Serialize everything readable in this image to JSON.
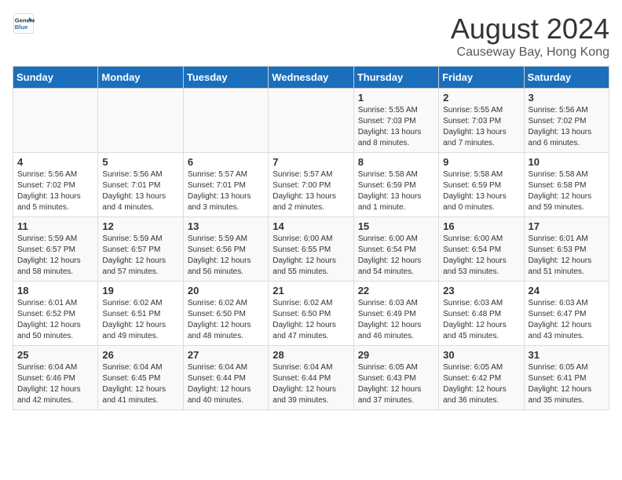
{
  "logo": {
    "line1": "General",
    "line2": "Blue"
  },
  "title": "August 2024",
  "location": "Causeway Bay, Hong Kong",
  "days_of_week": [
    "Sunday",
    "Monday",
    "Tuesday",
    "Wednesday",
    "Thursday",
    "Friday",
    "Saturday"
  ],
  "weeks": [
    [
      {
        "num": "",
        "info": ""
      },
      {
        "num": "",
        "info": ""
      },
      {
        "num": "",
        "info": ""
      },
      {
        "num": "",
        "info": ""
      },
      {
        "num": "1",
        "info": "Sunrise: 5:55 AM\nSunset: 7:03 PM\nDaylight: 13 hours\nand 8 minutes."
      },
      {
        "num": "2",
        "info": "Sunrise: 5:55 AM\nSunset: 7:03 PM\nDaylight: 13 hours\nand 7 minutes."
      },
      {
        "num": "3",
        "info": "Sunrise: 5:56 AM\nSunset: 7:02 PM\nDaylight: 13 hours\nand 6 minutes."
      }
    ],
    [
      {
        "num": "4",
        "info": "Sunrise: 5:56 AM\nSunset: 7:02 PM\nDaylight: 13 hours\nand 5 minutes."
      },
      {
        "num": "5",
        "info": "Sunrise: 5:56 AM\nSunset: 7:01 PM\nDaylight: 13 hours\nand 4 minutes."
      },
      {
        "num": "6",
        "info": "Sunrise: 5:57 AM\nSunset: 7:01 PM\nDaylight: 13 hours\nand 3 minutes."
      },
      {
        "num": "7",
        "info": "Sunrise: 5:57 AM\nSunset: 7:00 PM\nDaylight: 13 hours\nand 2 minutes."
      },
      {
        "num": "8",
        "info": "Sunrise: 5:58 AM\nSunset: 6:59 PM\nDaylight: 13 hours\nand 1 minute."
      },
      {
        "num": "9",
        "info": "Sunrise: 5:58 AM\nSunset: 6:59 PM\nDaylight: 13 hours\nand 0 minutes."
      },
      {
        "num": "10",
        "info": "Sunrise: 5:58 AM\nSunset: 6:58 PM\nDaylight: 12 hours\nand 59 minutes."
      }
    ],
    [
      {
        "num": "11",
        "info": "Sunrise: 5:59 AM\nSunset: 6:57 PM\nDaylight: 12 hours\nand 58 minutes."
      },
      {
        "num": "12",
        "info": "Sunrise: 5:59 AM\nSunset: 6:57 PM\nDaylight: 12 hours\nand 57 minutes."
      },
      {
        "num": "13",
        "info": "Sunrise: 5:59 AM\nSunset: 6:56 PM\nDaylight: 12 hours\nand 56 minutes."
      },
      {
        "num": "14",
        "info": "Sunrise: 6:00 AM\nSunset: 6:55 PM\nDaylight: 12 hours\nand 55 minutes."
      },
      {
        "num": "15",
        "info": "Sunrise: 6:00 AM\nSunset: 6:54 PM\nDaylight: 12 hours\nand 54 minutes."
      },
      {
        "num": "16",
        "info": "Sunrise: 6:00 AM\nSunset: 6:54 PM\nDaylight: 12 hours\nand 53 minutes."
      },
      {
        "num": "17",
        "info": "Sunrise: 6:01 AM\nSunset: 6:53 PM\nDaylight: 12 hours\nand 51 minutes."
      }
    ],
    [
      {
        "num": "18",
        "info": "Sunrise: 6:01 AM\nSunset: 6:52 PM\nDaylight: 12 hours\nand 50 minutes."
      },
      {
        "num": "19",
        "info": "Sunrise: 6:02 AM\nSunset: 6:51 PM\nDaylight: 12 hours\nand 49 minutes."
      },
      {
        "num": "20",
        "info": "Sunrise: 6:02 AM\nSunset: 6:50 PM\nDaylight: 12 hours\nand 48 minutes."
      },
      {
        "num": "21",
        "info": "Sunrise: 6:02 AM\nSunset: 6:50 PM\nDaylight: 12 hours\nand 47 minutes."
      },
      {
        "num": "22",
        "info": "Sunrise: 6:03 AM\nSunset: 6:49 PM\nDaylight: 12 hours\nand 46 minutes."
      },
      {
        "num": "23",
        "info": "Sunrise: 6:03 AM\nSunset: 6:48 PM\nDaylight: 12 hours\nand 45 minutes."
      },
      {
        "num": "24",
        "info": "Sunrise: 6:03 AM\nSunset: 6:47 PM\nDaylight: 12 hours\nand 43 minutes."
      }
    ],
    [
      {
        "num": "25",
        "info": "Sunrise: 6:04 AM\nSunset: 6:46 PM\nDaylight: 12 hours\nand 42 minutes."
      },
      {
        "num": "26",
        "info": "Sunrise: 6:04 AM\nSunset: 6:45 PM\nDaylight: 12 hours\nand 41 minutes."
      },
      {
        "num": "27",
        "info": "Sunrise: 6:04 AM\nSunset: 6:44 PM\nDaylight: 12 hours\nand 40 minutes."
      },
      {
        "num": "28",
        "info": "Sunrise: 6:04 AM\nSunset: 6:44 PM\nDaylight: 12 hours\nand 39 minutes."
      },
      {
        "num": "29",
        "info": "Sunrise: 6:05 AM\nSunset: 6:43 PM\nDaylight: 12 hours\nand 37 minutes."
      },
      {
        "num": "30",
        "info": "Sunrise: 6:05 AM\nSunset: 6:42 PM\nDaylight: 12 hours\nand 36 minutes."
      },
      {
        "num": "31",
        "info": "Sunrise: 6:05 AM\nSunset: 6:41 PM\nDaylight: 12 hours\nand 35 minutes."
      }
    ]
  ]
}
